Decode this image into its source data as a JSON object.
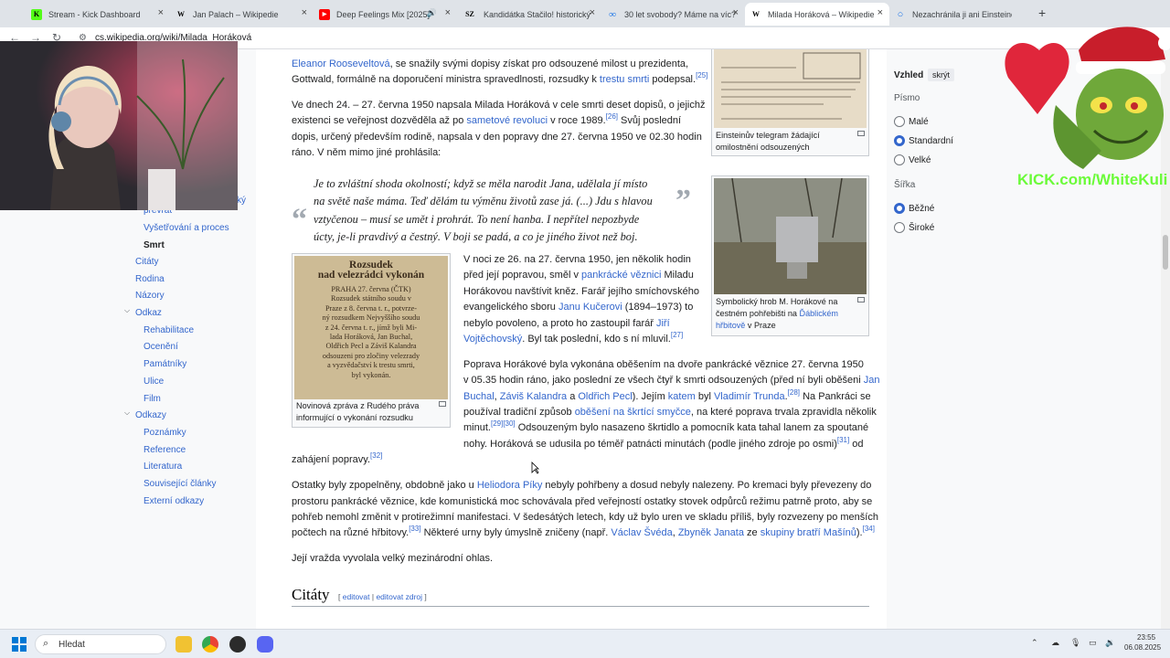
{
  "tabs": [
    {
      "label": "Stream - Kick Dashboard",
      "icon": "K",
      "color": "#53fc18"
    },
    {
      "label": "Jan Palach – Wikipedie",
      "icon": "W",
      "color": "#ffffff"
    },
    {
      "label": "Deep Feelings Mix [2025]",
      "icon": "▶",
      "color": "#ff0000"
    },
    {
      "label": "Kandidátka Stačilo! historický",
      "icon": "SZ",
      "color": "#ffffff"
    },
    {
      "label": "30 let svobody? Máme na víc?",
      "icon": "∞",
      "color": "#ffffff"
    },
    {
      "label": "Milada Horáková – Wikipedie",
      "icon": "W",
      "color": "#ffffff"
    },
    {
      "label": "Nezachránila ji ani Einsteinovo",
      "icon": "○",
      "color": "#ffffff"
    }
  ],
  "address": {
    "url": "cs.wikipedia.org/wiki/Milada_Horáková"
  },
  "toc": {
    "partial": "převrat",
    "partial_end": "ský",
    "items": [
      {
        "label": "Vyšetřování a proces",
        "level": 2
      },
      {
        "label": "Smrt",
        "level": 2,
        "current": true
      },
      {
        "label": "Citáty",
        "level": 1
      },
      {
        "label": "Rodina",
        "level": 1
      },
      {
        "label": "Názory",
        "level": 1
      },
      {
        "label": "Odkaz",
        "level": 1,
        "expanded": true
      },
      {
        "label": "Rehabilitace",
        "level": 2
      },
      {
        "label": "Ocenění",
        "level": 2
      },
      {
        "label": "Památníky",
        "level": 2
      },
      {
        "label": "Ulice",
        "level": 2
      },
      {
        "label": "Film",
        "level": 2
      },
      {
        "label": "Odkazy",
        "level": 1,
        "expanded": true
      },
      {
        "label": "Poznámky",
        "level": 2
      },
      {
        "label": "Reference",
        "level": 2
      },
      {
        "label": "Literatura",
        "level": 2
      },
      {
        "label": "Související články",
        "level": 2
      },
      {
        "label": "Externí odkazy",
        "level": 2
      }
    ]
  },
  "article": {
    "p1": {
      "l1": {
        "link": "Eleanor Rooseveltová",
        "text": ", se snažily svými dopisy získat pro odsouzené milost u prezidenta,"
      },
      "l2": {
        "a": "Gottwald, formálně na doporučení ministra spravedlnosti, rozsudky k ",
        "link": "trestu smrti",
        "b": " podepsal.",
        "ref": "[25]"
      }
    },
    "p2": {
      "l1": "Ve dnech 24. – 27. června 1950 napsala Milada Horáková v cele smrti deset dopisů, o jejichž",
      "l2": {
        "a": "existenci se veřejnost dozvěděla až po ",
        "link": "sametové revoluci",
        "b": " v roce 1989.",
        "ref": "[26]",
        "c": " Svůj poslední"
      },
      "l3": "dopis, určený především rodině, napsala v den popravy dne 27. června 1950 ve 02.30 hodin",
      "l4": "ráno. V něm mimo jiné prohlásila:"
    },
    "quote": {
      "l1": "Je to zvláštní shoda okolností; když se měla narodit Jana, udělala jí místo",
      "l2": "na světě naše máma. Teď dělám tu výměnu životů zase já. (...) Jdu s hlavou",
      "l3": "vztyčenou – musí se umět i prohrát. To není hanba. I nepřítel nepozbyde",
      "l4": "úcty, je-li pravdivý a čestný. V boji se padá, a co je jiného život než boj."
    },
    "p3": {
      "l1": "V noci ze 26. na 27. června 1950, jen několik hodin",
      "l2": {
        "a": "před její popravou, směl v ",
        "link": "pankrácké věznici",
        "b": " Miladu"
      },
      "l3": "Horákovou navštívit kněz. Farář jejího smíchovského",
      "l4": {
        "a": "evangelického sboru ",
        "link": "Janu Kučerovi",
        "b": " (1894–1973) to"
      },
      "l5": {
        "a": "nebylo povoleno, a proto ho zastoupil farář ",
        "link": "Jiří"
      },
      "l6": {
        "link": "Vojtěchovský",
        "b": ". Byl tak poslední, kdo s ní mluvil.",
        "ref": "[27]"
      }
    },
    "p4": {
      "l1": "Poprava Horákové byla vykonána oběšením na dvoře pankrácké věznice 27. června 1950",
      "l2": {
        "a": "v 05.35 hodin ráno, jako poslední ze všech čtyř k smrti odsouzených (před ní byli oběšeni ",
        "link": "Jan"
      },
      "l3": {
        "link1": "Buchal",
        ",": ", ",
        "link2": "Záviš Kalandra",
        "and": " a ",
        "link3": "Oldřich Pecl",
        "b": "). Jejím ",
        "link4": "katem",
        "c": " byl ",
        "red": "Vladimír Trunda",
        "d": ".",
        "ref": "[28]",
        "e": " Na Pankráci se"
      },
      "l4": {
        "a": "používal tradiční způsob ",
        "link": "oběšení na škrtící smyčce",
        "b": ", na které poprava trvala zpravidla několik"
      },
      "l5": {
        "a": "minut.",
        "ref": "[29][30]",
        "b": " Odsouzeným bylo nasazeno škrtidlo a pomocník kata tahal lanem za spoutané"
      },
      "l6": {
        "a": "nohy. Horáková se udusila po téměř patnácti minutách (podle jiného zdroje po osmi)",
        "ref": "[31]",
        "b": " od"
      },
      "l7": {
        "a": "zahájení popravy.",
        "ref": "[32]"
      }
    },
    "p5": {
      "l1": {
        "a": "Ostatky byly zpopelněny, obdobně jako u ",
        "link": "Heliodora Píky",
        "b": " nebyly pohřbeny a dosud nebyly nalezeny. Po kremaci byly převezeny do"
      },
      "l2": "prostoru pankrácké věznice, kde komunistická moc schovávala před veřejností ostatky stovek odpůrců režimu patrně proto, aby se",
      "l3": "pohřeb nemohl změnit v protirežimní manifestaci. V šedesátých letech, kdy už bylo uren ve skladu příliš, byly rozvezeny po menších",
      "l4": {
        "a": "počtech na různé hřbitovy.",
        "ref": "[33]",
        "b": " Některé urny byly úmyslně zničeny (např. ",
        "link1": "Václav Švéda",
        ",": ", ",
        "link2": "Zbyněk Janata",
        "c": " ze ",
        "link3": "skupiny bratří Mašínů",
        "d": ").",
        "ref2": "[34]"
      }
    },
    "p6": "Její vražda vyvolala velký mezinárodní ohlas.",
    "heading": "Citáty",
    "edit": {
      "a": "[ ",
      "l1": "editovat",
      "sep": " | ",
      "l2": "editovat zdroj",
      "b": " ]"
    }
  },
  "figures": {
    "telegram": {
      "caption1": "Einsteinův telegram žádající",
      "caption2": "omilostnění odsouzených"
    },
    "grave": {
      "c1": "Symbolický hrob M. Horákové na",
      "c2": {
        "a": "čestném pohřebišti na ",
        "link": "Ďáblickém"
      },
      "c3": {
        "link": "hřbitově",
        "b": " v Praze"
      }
    },
    "news": {
      "img_head1": "Rozsudek",
      "img_head2": "nad velezrádci vykonán",
      "img_body": [
        "PRAHA 27. června (ČTK)",
        "Rozsudek státního soudu v",
        "Praze z 8. června t. r., potvrze-",
        "ný rozsudkem Nejvyššího soudu",
        "z 24. června t. r., jímž byli Mi-",
        "lada Horáková, Jan Buchal,",
        "Oldřich Pecl a Záviš Kalandra",
        "odsouzeni pro zločiny velezrady",
        "a vyzvědačství k trestu smrti,",
        "byl vykonán."
      ],
      "caption1": "Novinová zpráva z Rudého práva",
      "caption2": "informující o vykonání rozsudku"
    }
  },
  "prefs": {
    "title": "Vzhled",
    "hide": "skrýt",
    "font_title": "Písmo",
    "font_options": [
      {
        "label": "Malé",
        "on": false
      },
      {
        "label": "Standardní",
        "on": true
      },
      {
        "label": "Velké",
        "on": false
      }
    ],
    "width_title": "Šířka",
    "width_options": [
      {
        "label": "Běžné",
        "on": true
      },
      {
        "label": "Široké",
        "on": false
      }
    ]
  },
  "overlay": {
    "kick_text": "KICK.com/WhiteKuli"
  },
  "taskbar": {
    "search": "Hledat",
    "time": "23:55",
    "date": "06.08.2025"
  }
}
